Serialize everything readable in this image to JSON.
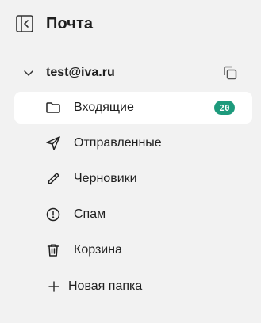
{
  "header": {
    "title": "Почта",
    "collapse_icon": "sidebar-collapse-icon"
  },
  "account": {
    "email": "test@iva.ru",
    "expand_icon": "chevron-down-icon",
    "copy_icon": "copy-icon"
  },
  "folders": [
    {
      "label": "Входящие",
      "icon": "folder-icon",
      "badge": "20",
      "active": true
    },
    {
      "label": "Отправленные",
      "icon": "send-icon"
    },
    {
      "label": "Черновики",
      "icon": "pencil-icon"
    },
    {
      "label": "Спам",
      "icon": "alert-circle-icon"
    },
    {
      "label": "Корзина",
      "icon": "trash-icon"
    }
  ],
  "new_folder": {
    "label": "Новая папка",
    "icon": "plus-icon"
  },
  "colors": {
    "background": "#f2f2f2",
    "active_item": "#ffffff",
    "badge": "#1d9a7c"
  }
}
